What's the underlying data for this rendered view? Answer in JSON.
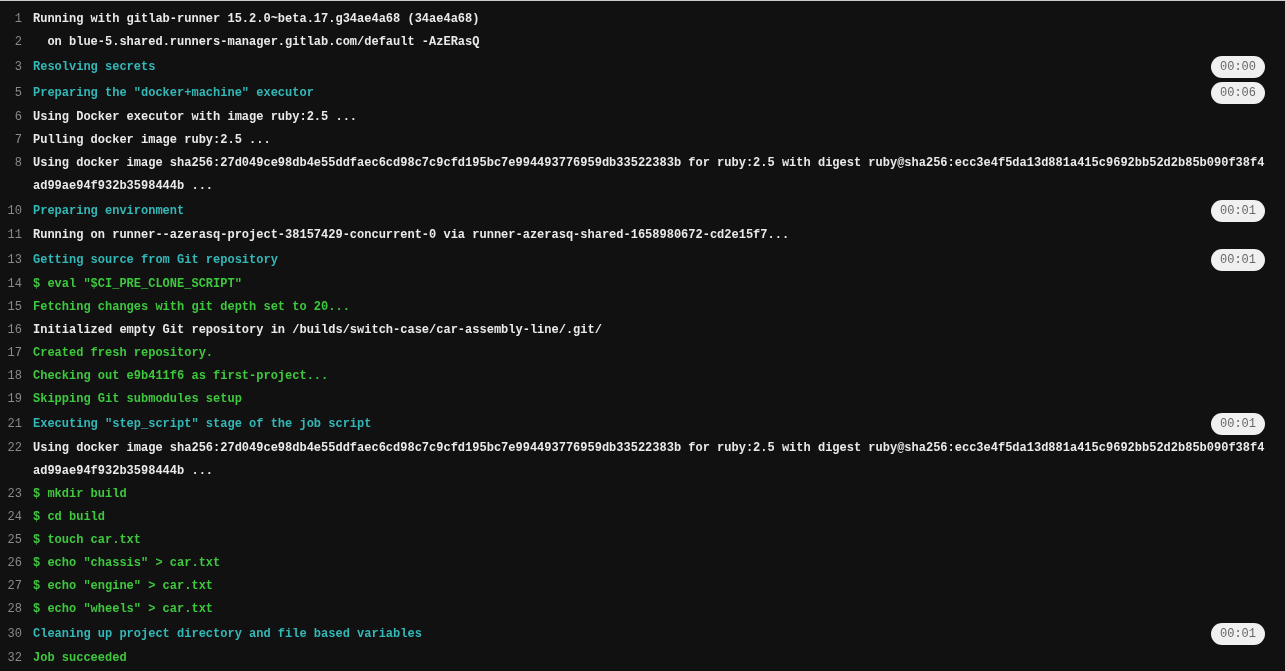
{
  "log_lines": [
    {
      "number": "1",
      "kind": "output",
      "text": "Running with gitlab-runner 15.2.0~beta.17.g34ae4a68 (34ae4a68)"
    },
    {
      "number": "2",
      "kind": "output",
      "text": "  on blue-5.shared.runners-manager.gitlab.com/default -AzERasQ"
    },
    {
      "number": "3",
      "kind": "section",
      "text": "Resolving secrets",
      "duration": "00:00"
    },
    {
      "number": "5",
      "kind": "section",
      "text": "Preparing the \"docker+machine\" executor",
      "duration": "00:06"
    },
    {
      "number": "6",
      "kind": "output",
      "text": "Using Docker executor with image ruby:2.5 ..."
    },
    {
      "number": "7",
      "kind": "output",
      "text": "Pulling docker image ruby:2.5 ..."
    },
    {
      "number": "8",
      "kind": "output",
      "text": "Using docker image sha256:27d049ce98db4e55ddfaec6cd98c7c9cfd195bc7e994493776959db33522383b for ruby:2.5 with digest ruby@sha256:ecc3e4f5da13d881a415c9692bb52d2b85b090f38f4ad99ae94f932b3598444b ..."
    },
    {
      "number": "10",
      "kind": "section",
      "text": "Preparing environment",
      "duration": "00:01"
    },
    {
      "number": "11",
      "kind": "output",
      "text": "Running on runner--azerasq-project-38157429-concurrent-0 via runner-azerasq-shared-1658980672-cd2e15f7..."
    },
    {
      "number": "13",
      "kind": "section",
      "text": "Getting source from Git repository",
      "duration": "00:01"
    },
    {
      "number": "14",
      "kind": "command",
      "text": "$ eval \"$CI_PRE_CLONE_SCRIPT\""
    },
    {
      "number": "15",
      "kind": "command",
      "text": "Fetching changes with git depth set to 20..."
    },
    {
      "number": "16",
      "kind": "output",
      "text": "Initialized empty Git repository in /builds/switch-case/car-assembly-line/.git/"
    },
    {
      "number": "17",
      "kind": "command",
      "text": "Created fresh repository."
    },
    {
      "number": "18",
      "kind": "command",
      "text": "Checking out e9b411f6 as first-project..."
    },
    {
      "number": "19",
      "kind": "command",
      "text": "Skipping Git submodules setup"
    },
    {
      "number": "21",
      "kind": "section",
      "text": "Executing \"step_script\" stage of the job script",
      "duration": "00:01"
    },
    {
      "number": "22",
      "kind": "output",
      "text": "Using docker image sha256:27d049ce98db4e55ddfaec6cd98c7c9cfd195bc7e994493776959db33522383b for ruby:2.5 with digest ruby@sha256:ecc3e4f5da13d881a415c9692bb52d2b85b090f38f4ad99ae94f932b3598444b ..."
    },
    {
      "number": "23",
      "kind": "command",
      "text": "$ mkdir build"
    },
    {
      "number": "24",
      "kind": "command",
      "text": "$ cd build"
    },
    {
      "number": "25",
      "kind": "command",
      "text": "$ touch car.txt"
    },
    {
      "number": "26",
      "kind": "command",
      "text": "$ echo \"chassis\" > car.txt"
    },
    {
      "number": "27",
      "kind": "command",
      "text": "$ echo \"engine\" > car.txt"
    },
    {
      "number": "28",
      "kind": "command",
      "text": "$ echo \"wheels\" > car.txt"
    },
    {
      "number": "30",
      "kind": "section",
      "text": "Cleaning up project directory and file based variables",
      "duration": "00:01"
    },
    {
      "number": "32",
      "kind": "command",
      "text": "Job succeeded"
    }
  ]
}
